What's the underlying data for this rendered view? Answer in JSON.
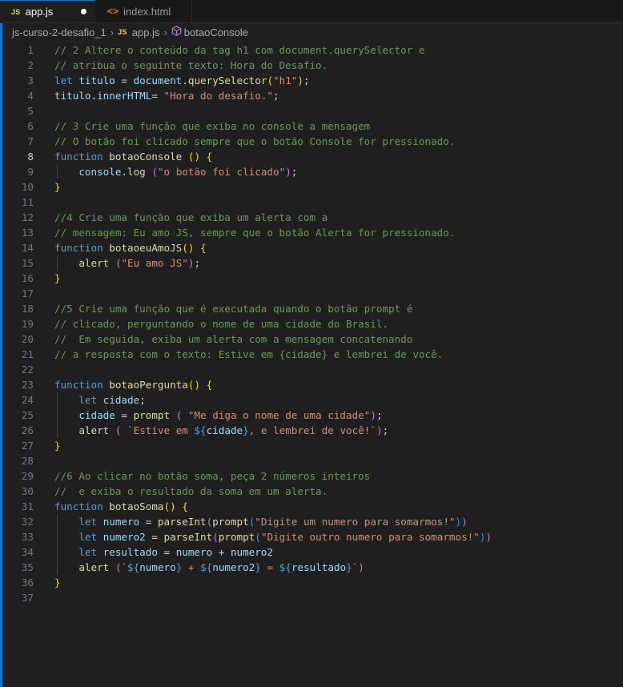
{
  "tabs": [
    {
      "label": "app.js",
      "icon": "JS",
      "active": true,
      "modified": true
    },
    {
      "label": "index.html",
      "icon": "<>",
      "active": false
    }
  ],
  "breadcrumb": {
    "folder": "js-curso-2-desafio_1",
    "file_icon": "JS",
    "file": "app.js",
    "symbol": "botaoConsole"
  },
  "editor": {
    "current_line": 8,
    "colors": {
      "background": "#1f1f1f",
      "comment": "#6a9955",
      "keyword": "#569cd6",
      "variable": "#9cdcfe",
      "function": "#dcdcaa",
      "string": "#ce9178",
      "bracket_gold": "#ffd700",
      "bracket_purple": "#da70d6",
      "bracket_blue": "#179fff",
      "default": "#d4d4d4",
      "accent": "#0078d4"
    },
    "lines": [
      {
        "n": 1,
        "code": "// 2 Altere o conteúdo da tag h1 com document.querySelector e"
      },
      {
        "n": 2,
        "code": "// atribua o seguinte texto: Hora do Desafio."
      },
      {
        "n": 3,
        "code": "let titulo = document.querySelector(\"h1\");"
      },
      {
        "n": 4,
        "code": "titulo.innerHTML= \"Hora do desafio.\";"
      },
      {
        "n": 5,
        "code": ""
      },
      {
        "n": 6,
        "code": "// 3 Crie uma função que exiba no console a mensagem"
      },
      {
        "n": 7,
        "code": "// O botão foi clicado sempre que o botão Console for pressionado."
      },
      {
        "n": 8,
        "code": "function botaoConsole () {"
      },
      {
        "n": 9,
        "code": "    console.log (\"o botão foi clicado\");"
      },
      {
        "n": 10,
        "code": "}"
      },
      {
        "n": 11,
        "code": ""
      },
      {
        "n": 12,
        "code": "//4 Crie uma função que exiba um alerta com a"
      },
      {
        "n": 13,
        "code": "// mensagem: Eu amo JS, sempre que o botão Alerta for pressionado."
      },
      {
        "n": 14,
        "code": "function botaoeuAmoJS() {"
      },
      {
        "n": 15,
        "code": "    alert (\"Eu amo JS\");"
      },
      {
        "n": 16,
        "code": "}"
      },
      {
        "n": 17,
        "code": ""
      },
      {
        "n": 18,
        "code": "//5 Crie uma função que é executada quando o botão prompt é"
      },
      {
        "n": 19,
        "code": "// clicado, perguntando o nome de uma cidade do Brasil."
      },
      {
        "n": 20,
        "code": "//  Em seguida, exiba um alerta com a mensagem concatenando"
      },
      {
        "n": 21,
        "code": "// a resposta com o texto: Estive em {cidade} e lembrei de você."
      },
      {
        "n": 22,
        "code": ""
      },
      {
        "n": 23,
        "code": "function botaoPergunta() {"
      },
      {
        "n": 24,
        "code": "    let cidade;"
      },
      {
        "n": 25,
        "code": "    cidade = prompt ( \"Me diga o nome de uma cidade\");"
      },
      {
        "n": 26,
        "code": "    alert ( `Estive em ${cidade}, e lembrei de você!`);"
      },
      {
        "n": 27,
        "code": "}"
      },
      {
        "n": 28,
        "code": ""
      },
      {
        "n": 29,
        "code": "//6 Ao clicar no botão soma, peça 2 números inteiros"
      },
      {
        "n": 30,
        "code": "//  e exiba o resultado da soma em um alerta."
      },
      {
        "n": 31,
        "code": "function botaoSoma() {"
      },
      {
        "n": 32,
        "code": "    let numero = parseInt(prompt(\"Digite um numero para somarmos!\"))"
      },
      {
        "n": 33,
        "code": "    let numero2 = parseInt(prompt(\"Digite outro numero para somarmos!\"))"
      },
      {
        "n": 34,
        "code": "    let resultado = numero + numero2"
      },
      {
        "n": 35,
        "code": "    alert (`${numero} + ${numero2} = ${resultado}`)"
      },
      {
        "n": 36,
        "code": "}"
      },
      {
        "n": 37,
        "code": ""
      }
    ]
  }
}
